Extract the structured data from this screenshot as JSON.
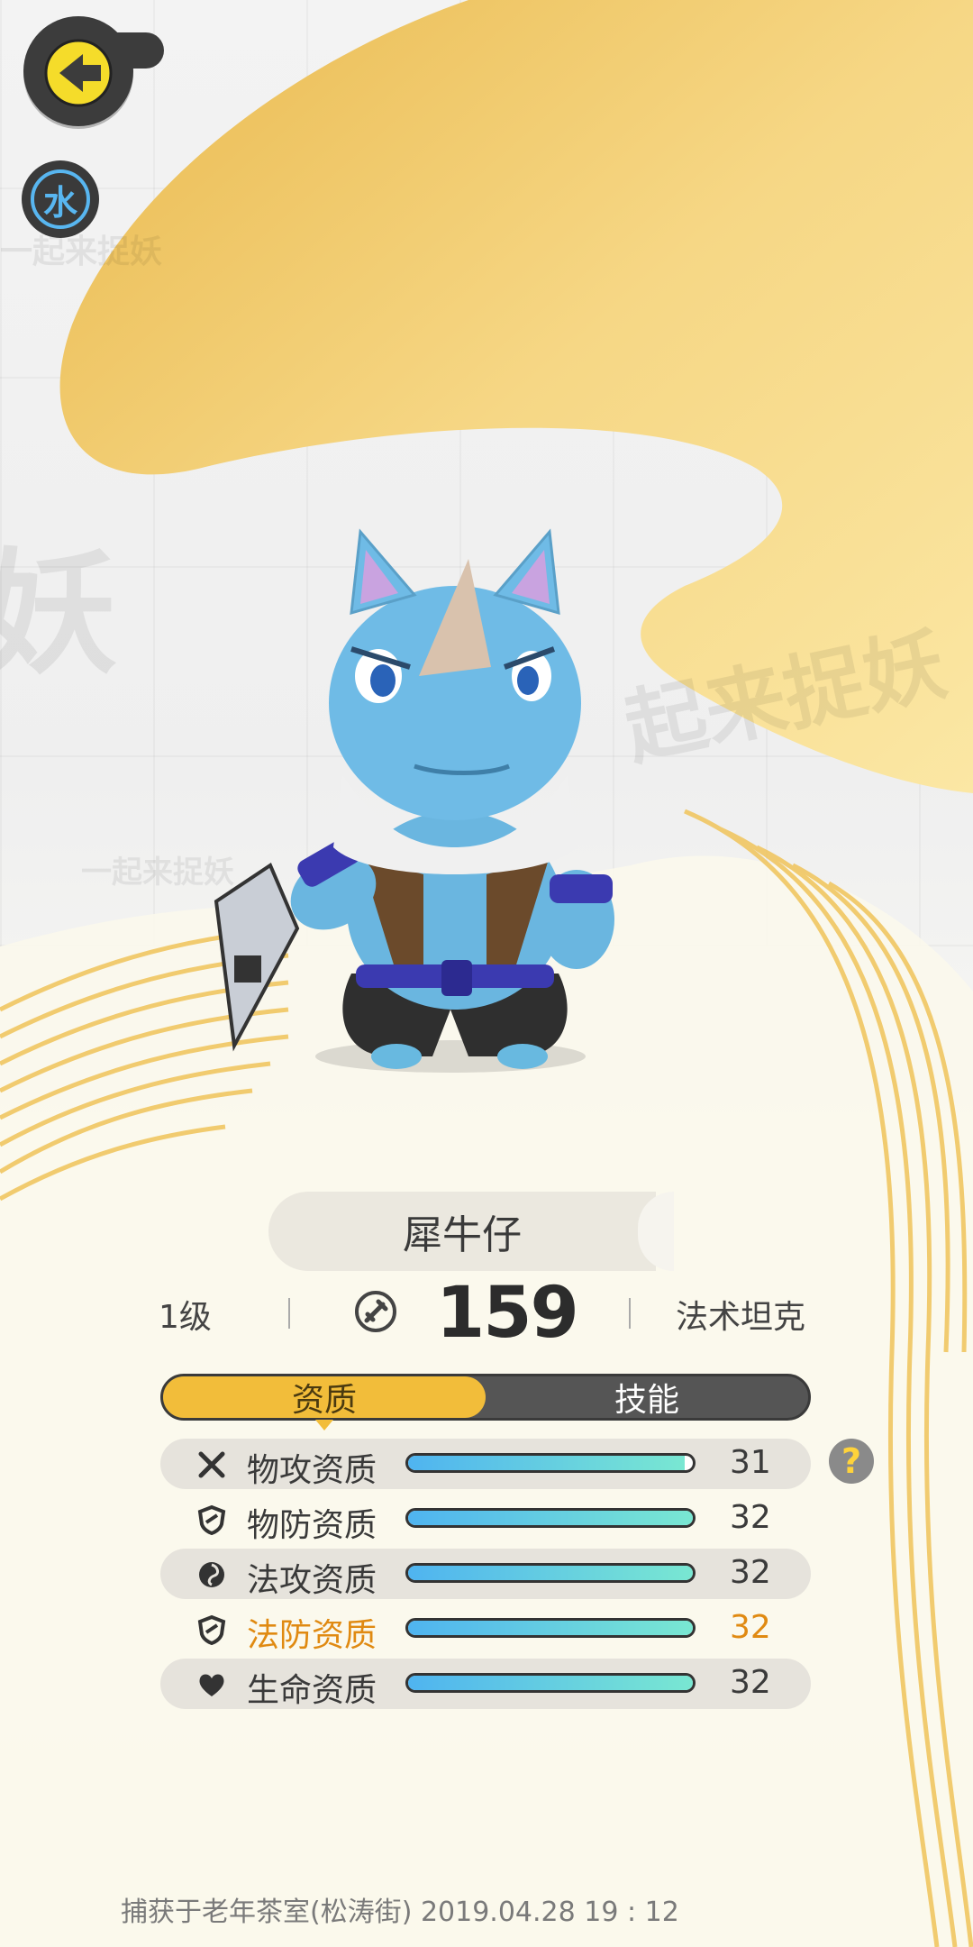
{
  "header": {
    "back_icon": "back-arrow-icon",
    "element_label": "水",
    "element_color": "#58b6f0"
  },
  "pet": {
    "name": "犀牛仔",
    "level": "1级",
    "power": "159",
    "role": "法术坦克"
  },
  "tabs": [
    {
      "label": "资质",
      "active": true
    },
    {
      "label": "技能",
      "active": false
    }
  ],
  "stats": [
    {
      "icon": "crossed-swords-icon",
      "label": "物攻资质",
      "value": "31",
      "fill": 0.97
    },
    {
      "icon": "shield-icon",
      "label": "物防资质",
      "value": "32",
      "fill": 1.0
    },
    {
      "icon": "magic-swirl-icon",
      "label": "法攻资质",
      "value": "32",
      "fill": 1.0
    },
    {
      "icon": "magic-shield-icon",
      "label": "法防资质",
      "value": "32",
      "fill": 1.0
    },
    {
      "icon": "heart-icon",
      "label": "生命资质",
      "value": "32",
      "fill": 1.0
    }
  ],
  "help": {
    "label": "?"
  },
  "footer": {
    "capture_info": "捕获于老年茶室(松涛街)  2019.04.28   19 : 12"
  },
  "colors": {
    "gold": "#f2bd3a",
    "highlight": "#e08a12",
    "bar_start": "#4fb4f0",
    "bar_end": "#79e7d2"
  }
}
